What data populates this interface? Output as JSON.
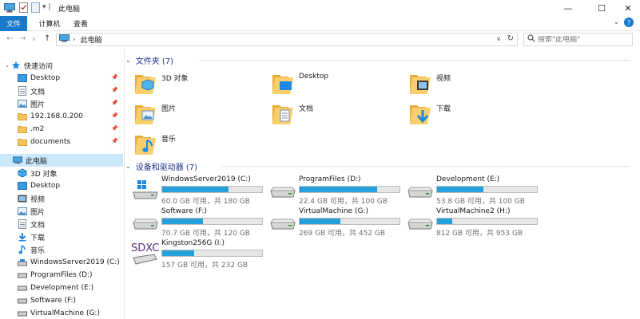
{
  "window": {
    "title": "此电脑",
    "controls": {
      "minimize": "—",
      "maximize": "☐",
      "close": "✕"
    }
  },
  "ribbon": {
    "tabs": [
      "文件",
      "计算机",
      "查看"
    ]
  },
  "address": {
    "path": "此电脑",
    "search_placeholder": "搜索\"此电脑\""
  },
  "nav": {
    "quick_access": {
      "label": "快速访问",
      "items": [
        {
          "label": "Desktop",
          "icon": "desktop-icon"
        },
        {
          "label": "文档",
          "icon": "document-icon"
        },
        {
          "label": "图片",
          "icon": "picture-icon"
        },
        {
          "label": "192.168.0.200",
          "icon": "folder-icon"
        },
        {
          "label": ".m2",
          "icon": "folder-icon"
        },
        {
          "label": "documents",
          "icon": "folder-icon"
        }
      ]
    },
    "this_pc": {
      "label": "此电脑",
      "items": [
        {
          "label": "3D 对象",
          "icon": "cube-icon"
        },
        {
          "label": "Desktop",
          "icon": "desktop-icon"
        },
        {
          "label": "视频",
          "icon": "video-icon"
        },
        {
          "label": "图片",
          "icon": "picture-icon"
        },
        {
          "label": "文档",
          "icon": "document-icon"
        },
        {
          "label": "下载",
          "icon": "download-icon"
        },
        {
          "label": "音乐",
          "icon": "music-icon"
        },
        {
          "label": "WindowsServer2019 (C:)",
          "icon": "windows-drive-icon"
        },
        {
          "label": "ProgramFiles (D:)",
          "icon": "drive-icon"
        },
        {
          "label": "Development (E:)",
          "icon": "drive-icon"
        },
        {
          "label": "Software (F:)",
          "icon": "drive-icon"
        },
        {
          "label": "VirtualMachine (G:)",
          "icon": "drive-icon"
        }
      ]
    }
  },
  "folders": {
    "header": "文件夹 (7)",
    "items": [
      {
        "label": "3D 对象",
        "icon": "cube-folder-icon"
      },
      {
        "label": "Desktop",
        "icon": "desktop-folder-icon"
      },
      {
        "label": "视频",
        "icon": "video-folder-icon"
      },
      {
        "label": "图片",
        "icon": "picture-folder-icon"
      },
      {
        "label": "文档",
        "icon": "document-folder-icon"
      },
      {
        "label": "下载",
        "icon": "download-folder-icon"
      },
      {
        "label": "音乐",
        "icon": "music-folder-icon"
      }
    ]
  },
  "drives": {
    "header": "设备和驱动器 (7)",
    "items": [
      {
        "name": "WindowsServer2019 (C:)",
        "free": "60.0 GB 可用，共 180 GB",
        "used_fraction": 0.667,
        "icon": "windows-drive-icon"
      },
      {
        "name": "ProgramFiles (D:)",
        "free": "22.4 GB 可用，共 100 GB",
        "used_fraction": 0.776,
        "icon": "drive-icon"
      },
      {
        "name": "Development (E:)",
        "free": "53.8 GB 可用，共 100 GB",
        "used_fraction": 0.462,
        "icon": "drive-icon"
      },
      {
        "name": "Software (F:)",
        "free": "70.7 GB 可用，共 120 GB",
        "used_fraction": 0.411,
        "icon": "drive-icon"
      },
      {
        "name": "VirtualMachine (G:)",
        "free": "269 GB 可用，共 452 GB",
        "used_fraction": 0.405,
        "icon": "drive-icon"
      },
      {
        "name": "VirtualMachine2 (H:)",
        "free": "812 GB 可用，共 953 GB",
        "used_fraction": 0.148,
        "icon": "drive-icon"
      },
      {
        "name": "Kingston256G (I:)",
        "free": "157 GB 可用，共 232 GB",
        "used_fraction": 0.323,
        "icon": "sdxc-card-icon",
        "card_text": "SDXC"
      }
    ]
  },
  "colors": {
    "accent": "#1979ca",
    "selection": "#cce8ff",
    "bar_fill": "#26a0da",
    "header_text": "#1e3287",
    "folder": "#f4c35a"
  }
}
